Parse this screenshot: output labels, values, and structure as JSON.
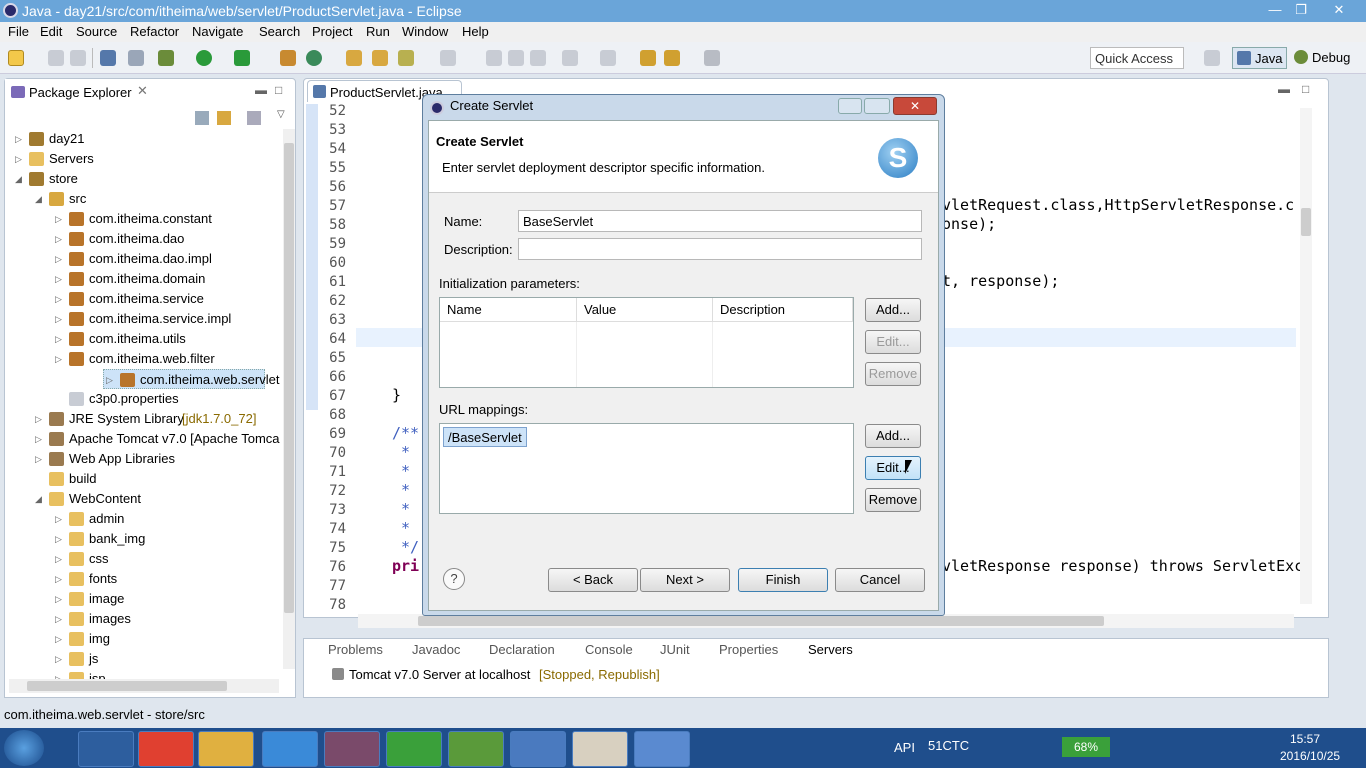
{
  "window": {
    "title": "Java - day21/src/com/itheima/web/servlet/ProductServlet.java - Eclipse",
    "controls": [
      "—",
      "❐",
      "✕"
    ]
  },
  "menu": [
    "File",
    "Edit",
    "Source",
    "Refactor",
    "Navigate",
    "Search",
    "Project",
    "Run",
    "Window",
    "Help"
  ],
  "toolbar": {
    "quick_access": "Quick Access",
    "perspective_java": "Java",
    "perspective_debug": "Debug"
  },
  "package_explorer": {
    "title": "Package Explorer",
    "items": [
      {
        "label": "day21",
        "depth": 0,
        "arrow": "▷",
        "icon": "project"
      },
      {
        "label": "Servers",
        "depth": 0,
        "arrow": "▷",
        "icon": "folder"
      },
      {
        "label": "store",
        "depth": 0,
        "arrow": "◢",
        "icon": "project"
      },
      {
        "label": "src",
        "depth": 1,
        "arrow": "◢",
        "icon": "src"
      },
      {
        "label": "com.itheima.constant",
        "depth": 2,
        "arrow": "▷",
        "icon": "package"
      },
      {
        "label": "com.itheima.dao",
        "depth": 2,
        "arrow": "▷",
        "icon": "package"
      },
      {
        "label": "com.itheima.dao.impl",
        "depth": 2,
        "arrow": "▷",
        "icon": "package"
      },
      {
        "label": "com.itheima.domain",
        "depth": 2,
        "arrow": "▷",
        "icon": "package"
      },
      {
        "label": "com.itheima.service",
        "depth": 2,
        "arrow": "▷",
        "icon": "package"
      },
      {
        "label": "com.itheima.service.impl",
        "depth": 2,
        "arrow": "▷",
        "icon": "package"
      },
      {
        "label": "com.itheima.utils",
        "depth": 2,
        "arrow": "▷",
        "icon": "package"
      },
      {
        "label": "com.itheima.web.filter",
        "depth": 2,
        "arrow": "▷",
        "icon": "package"
      },
      {
        "label": "com.itheima.web.servlet",
        "depth": 2,
        "arrow": "▷",
        "icon": "package",
        "selected": true
      },
      {
        "label": "c3p0.properties",
        "depth": 2,
        "arrow": "",
        "icon": "file"
      },
      {
        "label": "JRE System Library",
        "suffix": " [jdk1.7.0_72]",
        "depth": 1,
        "arrow": "▷",
        "icon": "lib"
      },
      {
        "label": "Apache Tomcat v7.0 [Apache Tomca",
        "depth": 1,
        "arrow": "▷",
        "icon": "lib"
      },
      {
        "label": "Web App Libraries",
        "depth": 1,
        "arrow": "▷",
        "icon": "lib"
      },
      {
        "label": "build",
        "depth": 1,
        "arrow": "",
        "icon": "folder"
      },
      {
        "label": "WebContent",
        "depth": 1,
        "arrow": "◢",
        "icon": "folder"
      },
      {
        "label": "admin",
        "depth": 2,
        "arrow": "▷",
        "icon": "folder"
      },
      {
        "label": "bank_img",
        "depth": 2,
        "arrow": "▷",
        "icon": "folder"
      },
      {
        "label": "css",
        "depth": 2,
        "arrow": "▷",
        "icon": "folder"
      },
      {
        "label": "fonts",
        "depth": 2,
        "arrow": "▷",
        "icon": "folder"
      },
      {
        "label": "image",
        "depth": 2,
        "arrow": "▷",
        "icon": "folder"
      },
      {
        "label": "images",
        "depth": 2,
        "arrow": "▷",
        "icon": "folder"
      },
      {
        "label": "img",
        "depth": 2,
        "arrow": "▷",
        "icon": "folder"
      },
      {
        "label": "js",
        "depth": 2,
        "arrow": "▷",
        "icon": "folder"
      },
      {
        "label": "jsp",
        "depth": 2,
        "arrow": "▷",
        "icon": "folder"
      }
    ]
  },
  "editor": {
    "tab": "ProductServlet.java",
    "line_numbers": [
      "52",
      "53",
      "54",
      "55",
      "56",
      "57",
      "58",
      "59",
      "60",
      "61",
      "62",
      "63",
      "64",
      "65",
      "66",
      "67",
      "68",
      "69",
      "70",
      "71",
      "72",
      "73",
      "74",
      "75",
      "76",
      "77",
      "78"
    ],
    "code_fragments": [
      {
        "line": "57",
        "text": "vletRequest.class,HttpServletResponse.c"
      },
      {
        "line": "58",
        "text": "onse);"
      },
      {
        "line": "61",
        "text": "t, response);"
      },
      {
        "line": "67",
        "text": "}"
      },
      {
        "line": "69",
        "text": "/**"
      },
      {
        "line": "70",
        "text": " *"
      },
      {
        "line": "71",
        "text": " *"
      },
      {
        "line": "72",
        "text": " *"
      },
      {
        "line": "73",
        "text": " *"
      },
      {
        "line": "74",
        "text": " *"
      },
      {
        "line": "75",
        "text": " */"
      },
      {
        "line": "76",
        "text": "pri"
      },
      {
        "line": "76b",
        "text": "vletResponse response) throws ServletExc"
      }
    ]
  },
  "bottom_panel": {
    "tabs": [
      "Problems",
      "Javadoc",
      "Declaration",
      "Console",
      "JUnit",
      "Properties",
      "Servers"
    ],
    "server_entry": "Tomcat v7.0 Server at localhost",
    "server_status": "[Stopped, Republish]"
  },
  "status_bar": "com.itheima.web.servlet - store/src",
  "dialog": {
    "window_title": "Create Servlet",
    "header_title": "Create Servlet",
    "header_desc": "Enter servlet deployment descriptor specific information.",
    "name_label": "Name:",
    "name_value": "BaseServlet",
    "description_label": "Description:",
    "description_value": "",
    "init_params_label": "Initialization parameters:",
    "init_columns": [
      "Name",
      "Value",
      "Description"
    ],
    "init_buttons": {
      "add": "Add...",
      "edit": "Edit...",
      "remove": "Remove"
    },
    "url_label": "URL mappings:",
    "url_items": [
      "/BaseServlet"
    ],
    "url_buttons": {
      "add": "Add...",
      "edit": "Edit...",
      "remove": "Remove"
    },
    "back": "< Back",
    "next": "Next >",
    "finish": "Finish",
    "cancel": "Cancel",
    "help": "?"
  },
  "taskbar": {
    "tray": {
      "api": "API",
      "app": "51CTC",
      "battery": "68%",
      "time": "15:57",
      "date": "2016/10/25"
    }
  }
}
